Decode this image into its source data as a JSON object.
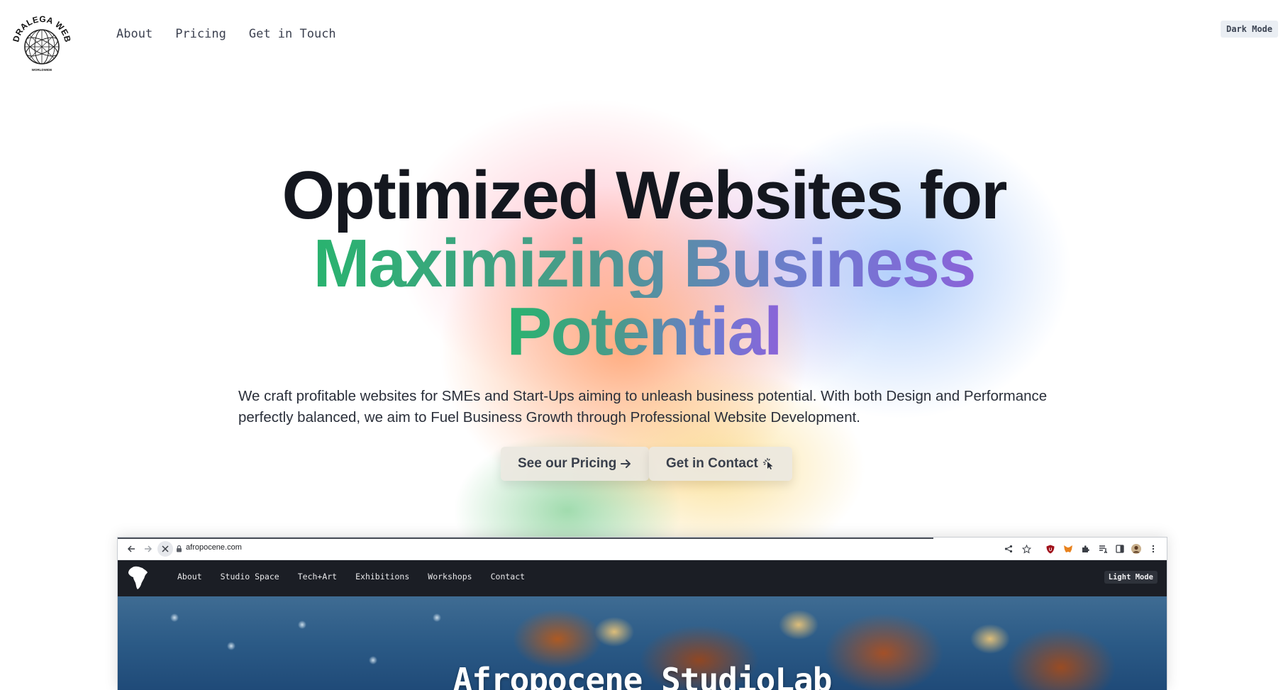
{
  "logo": {
    "alt": "DRALEGA WEB OPS WORLDWIDE",
    "icon": "globe-icon"
  },
  "nav": {
    "items": [
      "About",
      "Pricing",
      "Get in Touch"
    ]
  },
  "theme_toggle": "Dark Mode",
  "hero": {
    "line1": "Optimized Websites for",
    "line2": "Maximizing Business",
    "line3": "Potential",
    "subtext": "We craft profitable websites for SMEs and Start-Ups aiming to unleash business potential. With both Design and Performance perfectly balanced, we aim to Fuel Business Growth through Professional Website Development.",
    "cta_pricing": "See our Pricing",
    "cta_contact": "Get in Contact"
  },
  "mockup": {
    "url": "afropocene.com",
    "nav_items": [
      "About",
      "Studio Space",
      "Tech+Art",
      "Exhibitions",
      "Workshops",
      "Contact"
    ],
    "theme_toggle": "Light Mode",
    "hero_title": "Afropocene StudioLab"
  },
  "colors": {
    "heading": "#14171f",
    "gradient_start": "#29b36f",
    "gradient_end": "#8a63d8",
    "button_bg": "#ebe8e0",
    "mock_nav_bg": "#1b1e25"
  }
}
